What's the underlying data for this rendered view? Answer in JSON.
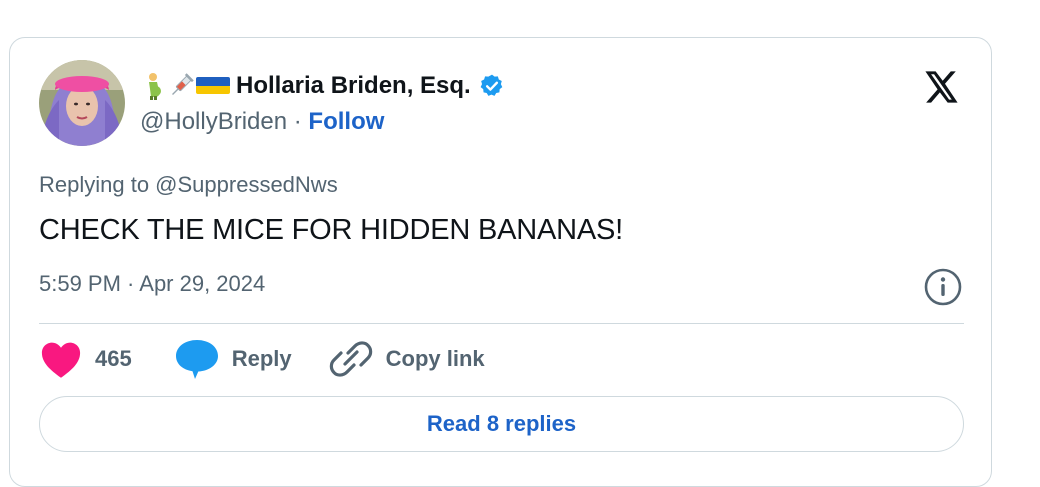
{
  "author": {
    "display_name": "Hollaria Briden, Esq.",
    "handle": "@HollyBriden",
    "separator": " · ",
    "follow_label": "Follow",
    "verified": true,
    "name_emojis": [
      "pregnant-man-emoji",
      "syringe-emoji",
      "ukraine-flag-emoji"
    ]
  },
  "platform_logo": "x-logo-icon",
  "tweet": {
    "reply_context": "Replying to @SuppressedNws",
    "text": "CHECK THE MICE FOR HIDDEN BANANAS!",
    "timestamp": "5:59 PM · Apr 29, 2024"
  },
  "actions": {
    "like_count": "465",
    "reply_label": "Reply",
    "copy_link_label": "Copy link"
  },
  "read_replies_label": "Read 8 replies",
  "colors": {
    "like": "#f91880",
    "reply_bubble": "#1d9bf0",
    "link_blue": "#1d63c8",
    "verified": "#1d9bf0",
    "secondary_text": "#536471",
    "primary_text": "#0f1419",
    "border": "#cfd9de"
  }
}
